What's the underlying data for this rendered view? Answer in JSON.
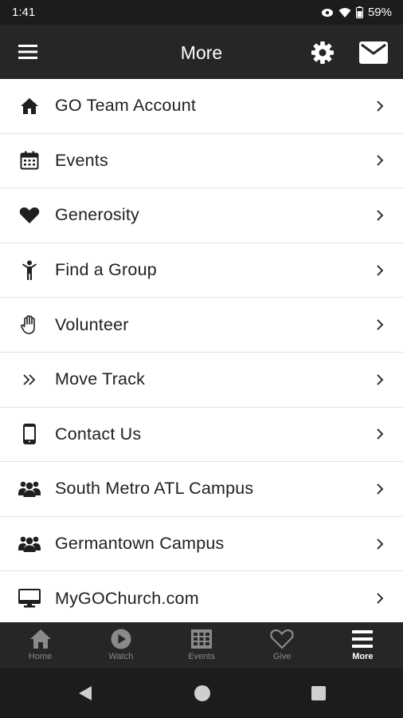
{
  "status_bar": {
    "time": "1:41",
    "battery": "59%",
    "icons": [
      "eye-comfort-icon",
      "wifi-icon",
      "battery-icon"
    ]
  },
  "header": {
    "title": "More",
    "left_icon": "hamburger-menu-icon",
    "right_icons": [
      "gear-icon",
      "envelope-icon"
    ]
  },
  "menu": {
    "items": [
      {
        "label": "GO Team Account",
        "icon": "home-icon"
      },
      {
        "label": "Events",
        "icon": "calendar-icon"
      },
      {
        "label": "Generosity",
        "icon": "heart-icon"
      },
      {
        "label": "Find a Group",
        "icon": "person-icon"
      },
      {
        "label": "Volunteer",
        "icon": "hand-icon"
      },
      {
        "label": "Move Track",
        "icon": "double-chevron-icon"
      },
      {
        "label": "Contact Us",
        "icon": "phone-icon"
      },
      {
        "label": "South Metro ATL Campus",
        "icon": "group-icon"
      },
      {
        "label": "Germantown Campus",
        "icon": "group-icon"
      },
      {
        "label": "MyGOChurch.com",
        "icon": "monitor-icon"
      }
    ]
  },
  "tabs": [
    {
      "label": "Home",
      "icon": "home-icon",
      "active": false
    },
    {
      "label": "Watch",
      "icon": "play-circle-icon",
      "active": false
    },
    {
      "label": "Events",
      "icon": "calendar-grid-icon",
      "active": false
    },
    {
      "label": "Give",
      "icon": "heart-outline-icon",
      "active": false
    },
    {
      "label": "More",
      "icon": "hamburger-menu-icon",
      "active": true
    }
  ],
  "colors": {
    "app_bar": "#262626",
    "status_bar": "#1c1c1c",
    "tab_inactive": "#8a8a8a",
    "tab_active": "#ffffff"
  }
}
